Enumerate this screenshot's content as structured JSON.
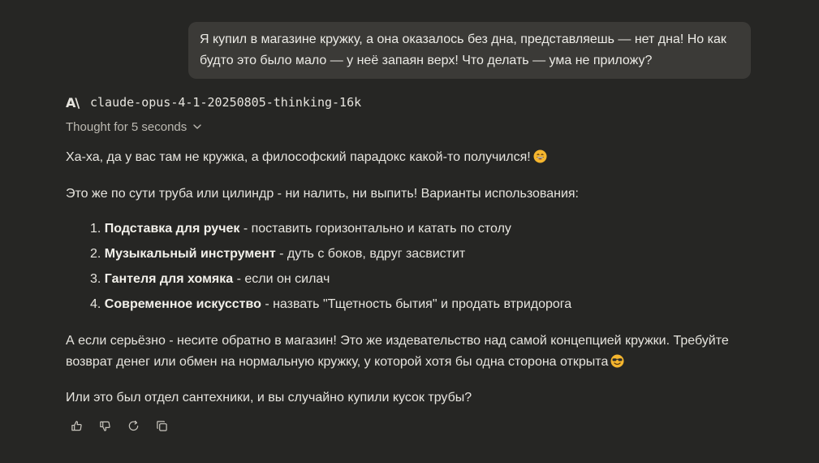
{
  "user_message": {
    "line1": "Я купил в магазине кружку, а она оказалось без дна, представляешь — нет дна! Но как",
    "line2": "будто это было мало — у неё запаян верх! Что делать — ума не приложу?"
  },
  "model": {
    "logo": "A\\",
    "name": "claude-opus-4-1-20250805-thinking-16k",
    "thought_label": "Thought for 5 seconds"
  },
  "answer": {
    "p1": "Ха-ха, да у вас там не кружка, а философский парадокс какой-то получился!",
    "p2": "Это же по сути труба или цилиндр - ни налить, ни выпить! Варианты использования:",
    "list": [
      {
        "num": "1.",
        "title": "Подставка для ручек",
        "text": " - поставить горизонтально и катать по столу"
      },
      {
        "num": "2.",
        "title": "Музыкальный инструмент",
        "text": " - дуть с боков, вдруг засвистит"
      },
      {
        "num": "3.",
        "title": "Гантеля для хомяка",
        "text": " - если он силач"
      },
      {
        "num": "4.",
        "title": "Современное искусство",
        "text": " - назвать \"Тщетность бытия\" и продать втридорога"
      }
    ],
    "p3_line1": "А если серьёзно - несите обратно в магазин! Это же издевательство над самой концепцией кружки. Требуйте",
    "p3_line2": "возврат денег или обмен на нормальную кружку, у которой хотя бы одна сторона открыта",
    "p4": "Или это был отдел сантехники, и вы случайно купили кусок трубы?"
  },
  "icons": {
    "emoji1": "grinning-face-emoji-icon",
    "emoji2": "smiling-face-with-sunglasses-emoji-icon",
    "actions": [
      "thumbs-up-icon",
      "thumbs-down-icon",
      "retry-icon",
      "copy-icon"
    ]
  },
  "colors": {
    "background": "#262624",
    "user_bubble": "#3b3a37",
    "text": "#e6e4de",
    "muted": "#bdbab2",
    "emoji": "#f5b62e"
  }
}
